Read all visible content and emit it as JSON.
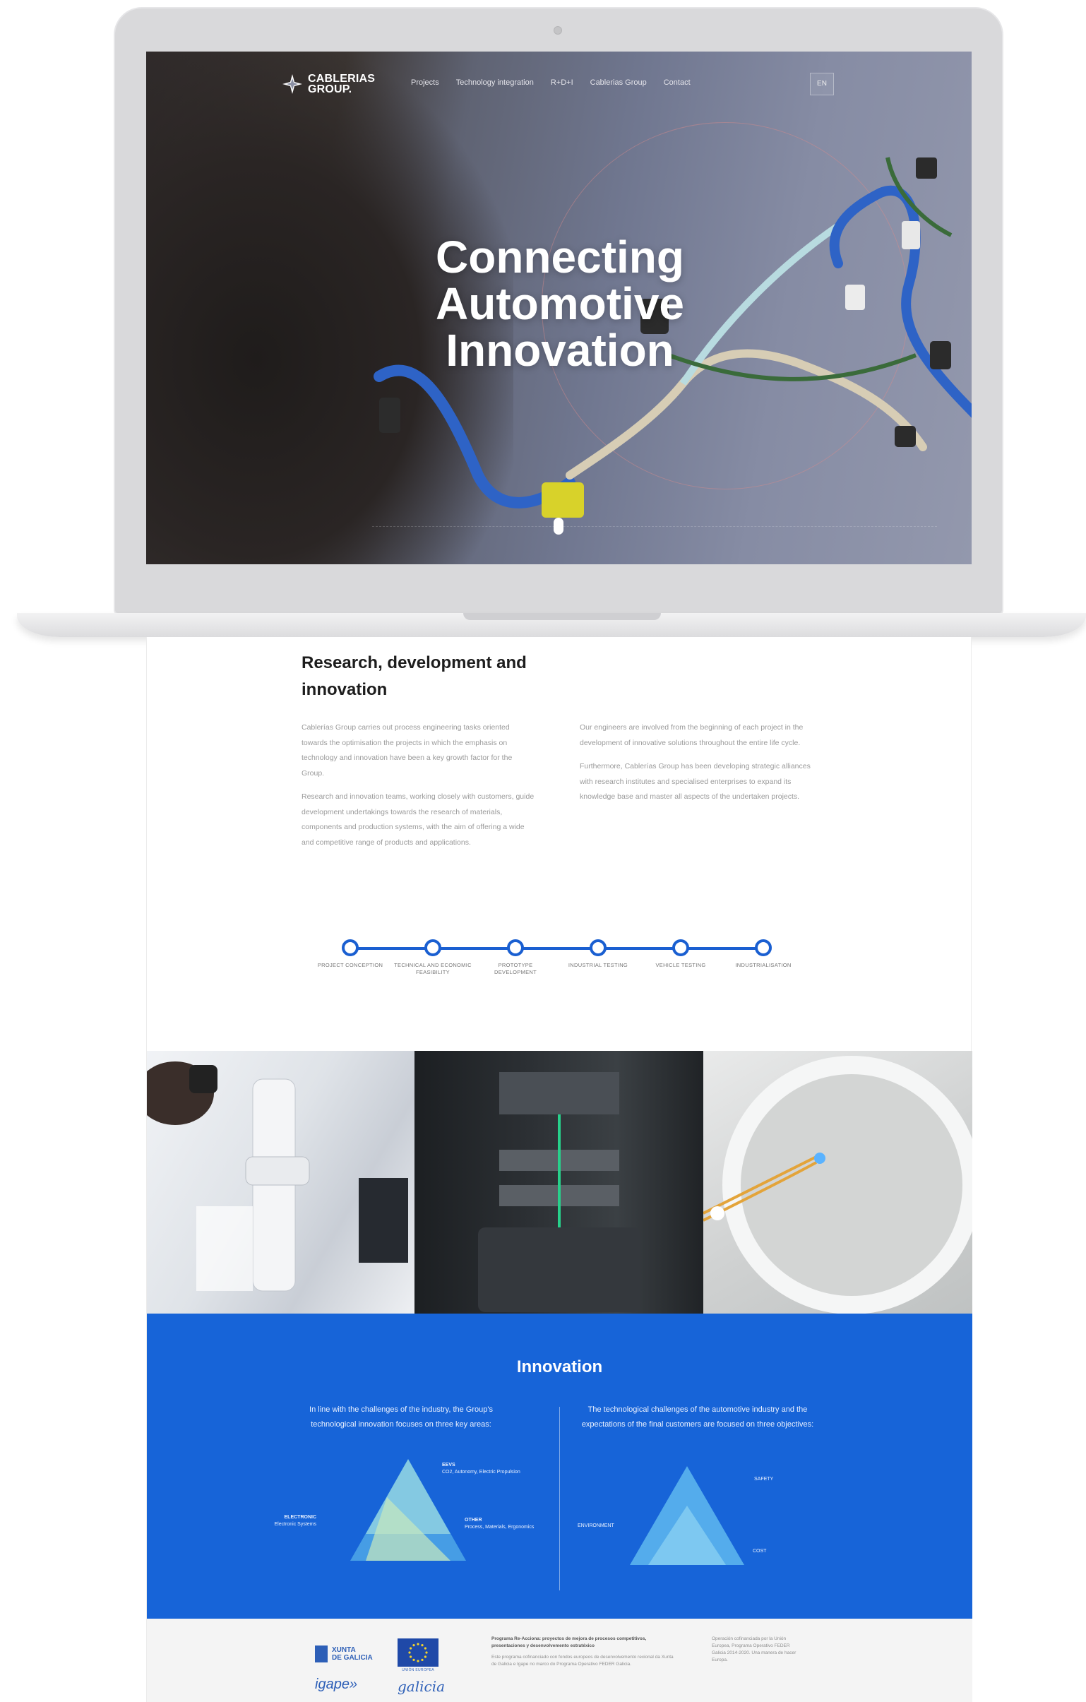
{
  "brand": {
    "name_line1": "CABLERIAS",
    "name_line2": "GROUP."
  },
  "nav": {
    "items": [
      "Projects",
      "Technology integration",
      "R+D+I",
      "Cablerias Group",
      "Contact"
    ],
    "language": "EN"
  },
  "hero": {
    "title_line1": "Connecting",
    "title_line2": "Automotive",
    "title_line3": "Innovation"
  },
  "rd": {
    "title": "Research, development and innovation",
    "left_paragraph1": "Cablerías Group carries out process engineering tasks oriented towards the optimisation the projects in which the emphasis on technology and innovation have been a key growth factor for the Group.",
    "left_paragraph2": "Research and innovation teams, working closely with customers, guide development undertakings towards the research of materials, components and production systems, with the aim of offering a wide and competitive range of products and applications.",
    "right_paragraph1": "Our engineers are involved from the beginning of each project in the development of innovative solutions throughout the entire life cycle.",
    "right_paragraph2": "Furthermore, Cablerías Group has been developing strategic alliances with research institutes and specialised enterprises to expand its knowledge base and master all aspects of the undertaken projects."
  },
  "timeline": {
    "steps": [
      "PROJECT CONCEPTION",
      "TECHNICAL AND ECONOMIC FEASIBILITY",
      "PROTOTYPE DEVELOPMENT",
      "INDUSTRIAL TESTING",
      "VEHICLE TESTING",
      "INDUSTRIALISATION"
    ]
  },
  "innovation": {
    "title": "Innovation",
    "left_text": "In line with the challenges of the industry, the Group's technological innovation focuses on three key areas:",
    "right_text": "The technological challenges of the automotive industry and the expectations of the final customers are focused on three objectives:",
    "left_triangle": {
      "top_label": "EEVS",
      "top_detail": "CO2, Autonomy, Electric Propulsion",
      "left_label": "ELECTRONIC",
      "left_detail": "Electronic Systems",
      "right_label": "OTHER",
      "right_detail": "Process, Materials, Ergonomics"
    },
    "right_triangle": {
      "top_label": "SAFETY",
      "left_label": "ENVIRONMENT",
      "right_label": "COST"
    },
    "colors": {
      "background": "#1764d8"
    }
  },
  "footer": {
    "xunta_line1": "XUNTA",
    "xunta_line2": "DE GALICIA",
    "eu_caption": "UNIÓN EUROPEA",
    "igape": "igape»",
    "galicia": "galicia",
    "mid_title": "Programa Re-Acciona: proyectos de mejora de procesos competitivos, presentaciones y desenvolvemento estratéxico",
    "mid_text": "Este programa cofinanciado con fondos europeos de desenvolvemento rexional da Xunta de Galicia e Igape no marco do Programa Operativo FEDER Galicia.",
    "right_text": "Operación cofinanciada por la Unión Europea, Programa Operativo FEDER Galicia 2014-2020. Una manera de hacer Europa."
  }
}
